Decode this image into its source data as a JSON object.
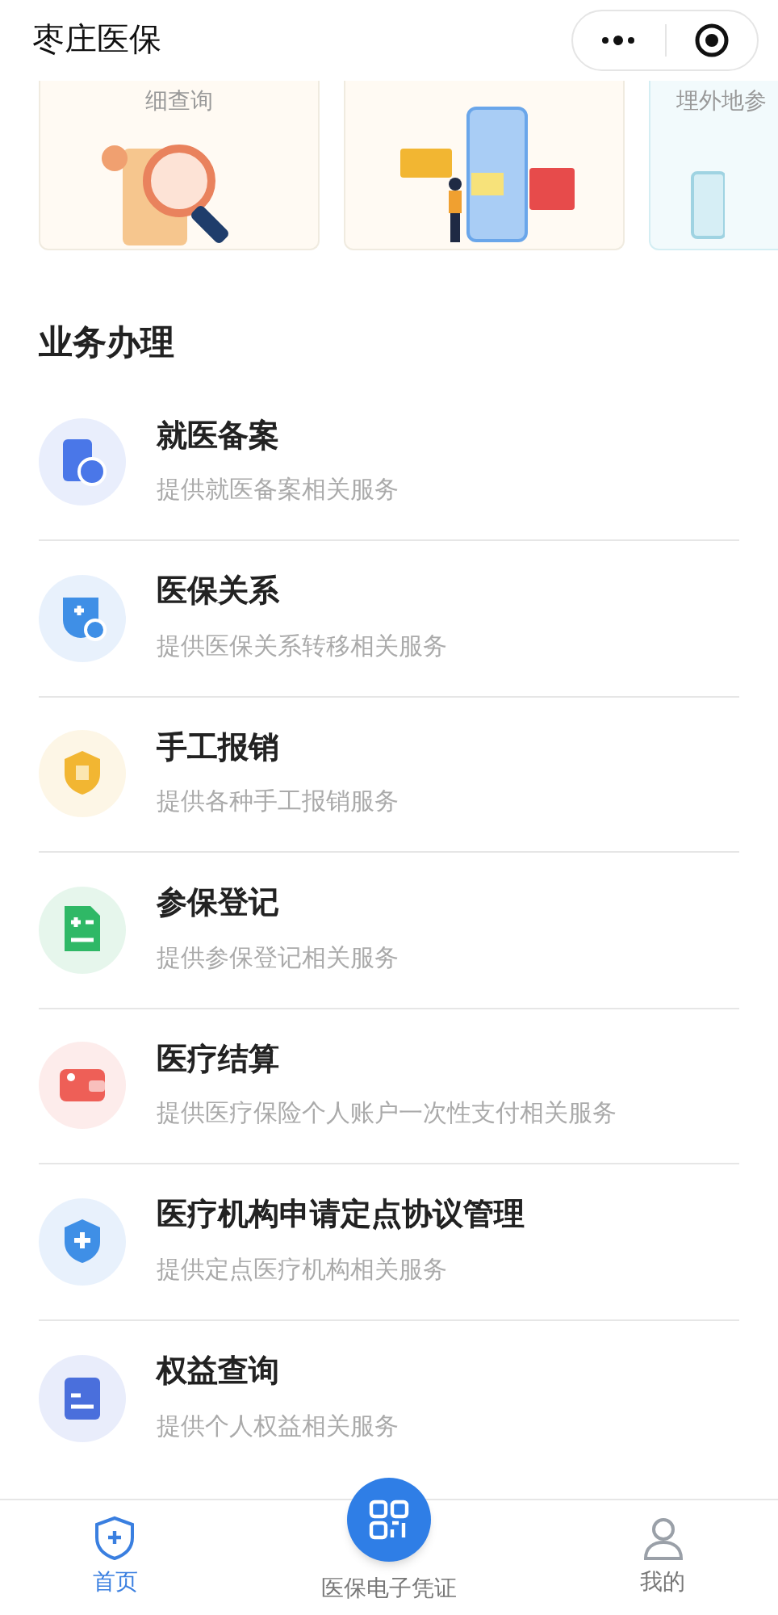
{
  "header": {
    "title": "枣庄医保"
  },
  "cards": [
    {
      "kind": "search",
      "caption": "细查询"
    },
    {
      "kind": "phone"
    },
    {
      "kind": "other",
      "caption": "埋外地参"
    }
  ],
  "section": {
    "title": "业务办理"
  },
  "services": [
    {
      "kind": "record",
      "title": "就医备案",
      "subtitle": "提供就医备案相关服务",
      "color": "#4a77e8"
    },
    {
      "kind": "transfer",
      "title": "医保关系",
      "subtitle": "提供医保关系转移相关服务",
      "color": "#3f8fe6"
    },
    {
      "kind": "reimburse",
      "title": "手工报销",
      "subtitle": "提供各种手工报销服务",
      "color": "#f2b632"
    },
    {
      "kind": "register",
      "title": "参保登记",
      "subtitle": "提供参保登记相关服务",
      "color": "#2fb866"
    },
    {
      "kind": "settle",
      "title": "医疗结算",
      "subtitle": "提供医疗保险个人账户一次性支付相关服务",
      "color": "#ee5f57"
    },
    {
      "kind": "shield",
      "title": "医疗机构申请定点协议管理",
      "subtitle": "提供定点医疗机构相关服务",
      "color": "#3f8fe6"
    },
    {
      "kind": "rights",
      "title": "权益查询",
      "subtitle": "提供个人权益相关服务",
      "color": "#4a6fdc"
    }
  ],
  "tabbar": [
    {
      "kind": "home",
      "label": "首页",
      "selected": true
    },
    {
      "kind": "qr",
      "label": "医保电子凭证",
      "selected": false
    },
    {
      "kind": "user",
      "label": "我的",
      "selected": false
    }
  ]
}
